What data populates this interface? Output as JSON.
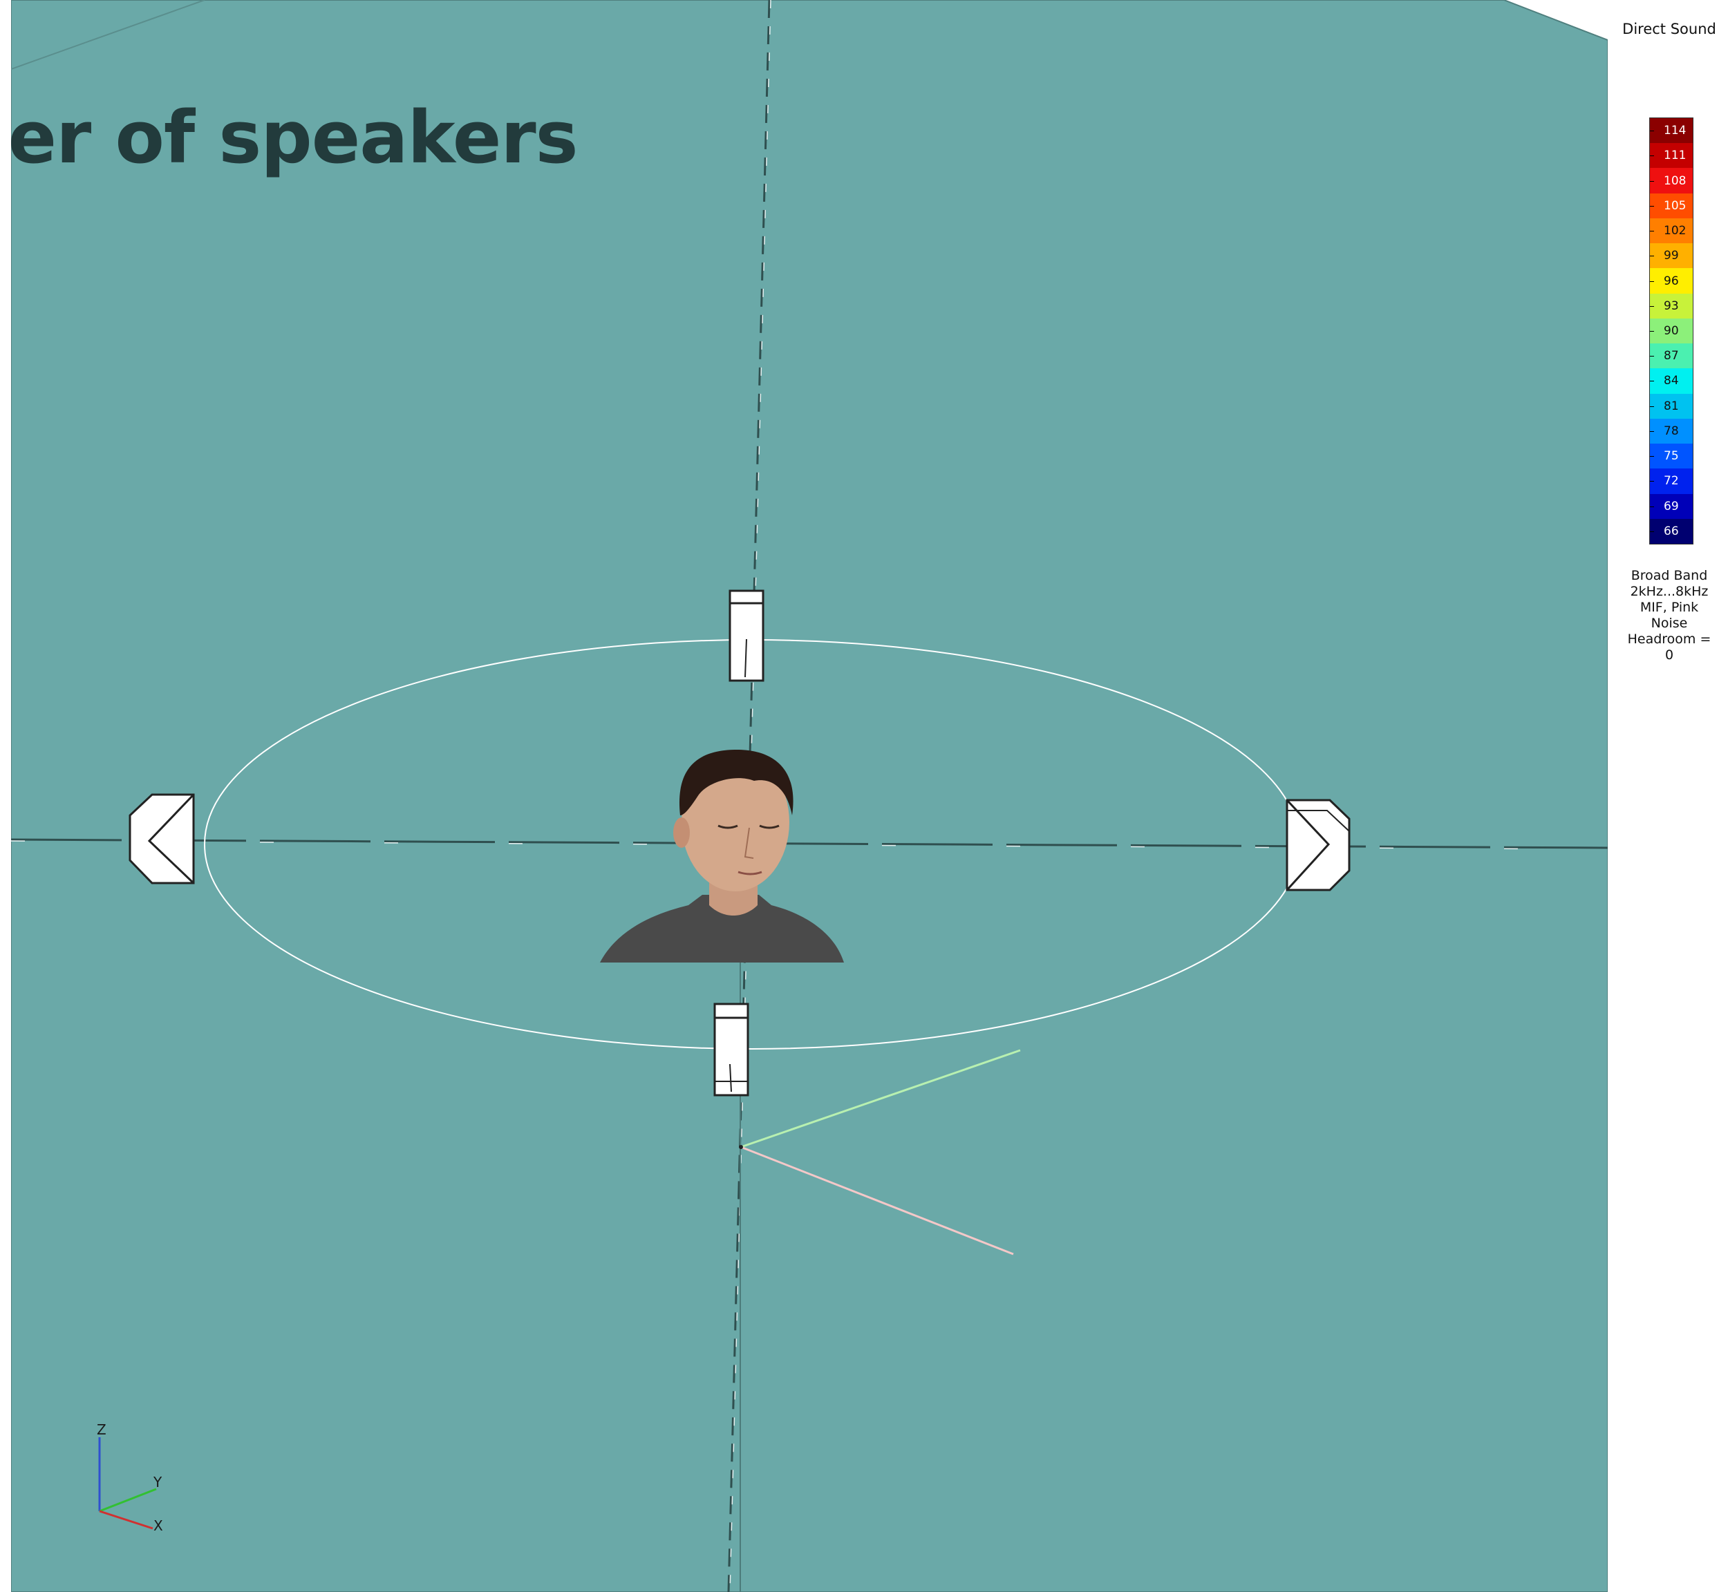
{
  "slide": {
    "title": "ber of speakers"
  },
  "scene": {
    "background_color": "#6aa9a8",
    "listener": {
      "image": "listener-photo"
    },
    "speakers": [
      {
        "name": "front"
      },
      {
        "name": "rear"
      },
      {
        "name": "left"
      },
      {
        "name": "right"
      }
    ],
    "axis_gizmo": {
      "z_label": "Z",
      "y_label": "Y",
      "x_label": "X"
    }
  },
  "legend": {
    "title": "Direct Sound",
    "scale": [
      {
        "value": "114",
        "color": "#8b0000",
        "text_color": "#ffffff"
      },
      {
        "value": "111",
        "color": "#c40000",
        "text_color": "#ffffff"
      },
      {
        "value": "108",
        "color": "#ef1010",
        "text_color": "#ffffff"
      },
      {
        "value": "105",
        "color": "#ff4d00",
        "text_color": "#ffffff"
      },
      {
        "value": "102",
        "color": "#ff7f00",
        "text_color": "#111111"
      },
      {
        "value": "99",
        "color": "#ffb000",
        "text_color": "#111111"
      },
      {
        "value": "96",
        "color": "#ffee00",
        "text_color": "#111111"
      },
      {
        "value": "93",
        "color": "#c8f23a",
        "text_color": "#111111"
      },
      {
        "value": "90",
        "color": "#8cf07a",
        "text_color": "#111111"
      },
      {
        "value": "87",
        "color": "#4bf0b0",
        "text_color": "#111111"
      },
      {
        "value": "84",
        "color": "#00f0f0",
        "text_color": "#111111"
      },
      {
        "value": "81",
        "color": "#00c2f0",
        "text_color": "#111111"
      },
      {
        "value": "78",
        "color": "#0090ff",
        "text_color": "#111111"
      },
      {
        "value": "75",
        "color": "#0055ff",
        "text_color": "#ffffff"
      },
      {
        "value": "72",
        "color": "#0022ee",
        "text_color": "#ffffff"
      },
      {
        "value": "69",
        "color": "#0000b8",
        "text_color": "#ffffff"
      },
      {
        "value": "66",
        "color": "#000070",
        "text_color": "#ffffff"
      }
    ],
    "info_lines": [
      "Broad Band",
      "2kHz...8kHz",
      "MIF, Pink",
      "Noise",
      "Headroom =",
      "0"
    ]
  }
}
